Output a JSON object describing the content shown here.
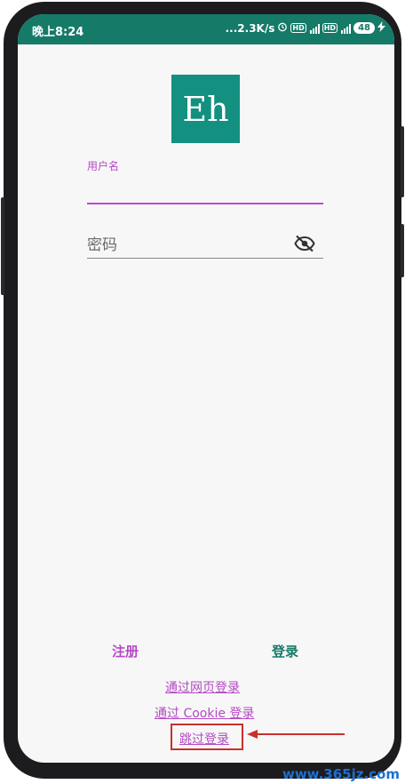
{
  "status_bar": {
    "time": "晚上8:24",
    "speed": "...2.3K/s",
    "hd1": "HD",
    "hd2": "HD",
    "battery": "48"
  },
  "logo": {
    "text": "Eh"
  },
  "form": {
    "username_label": "用户名",
    "username_value": "",
    "password_placeholder": "密码"
  },
  "actions": {
    "register": "注册",
    "login": "登录"
  },
  "links": {
    "web_login": "通过网页登录",
    "cookie_login": "通过 Cookie 登录",
    "skip_login": "跳过登录"
  },
  "watermark": "www.365jz.com",
  "colors": {
    "status_bar": "#167a68",
    "logo_bg": "#13907f",
    "accent_purple": "#b44ac4",
    "accent_teal": "#167a68",
    "annotation_red": "#c9302c"
  },
  "icons": {
    "password_toggle": "eye-off-icon",
    "alarm": "alarm-icon",
    "signal": "signal-icon",
    "charging": "bolt-icon"
  }
}
